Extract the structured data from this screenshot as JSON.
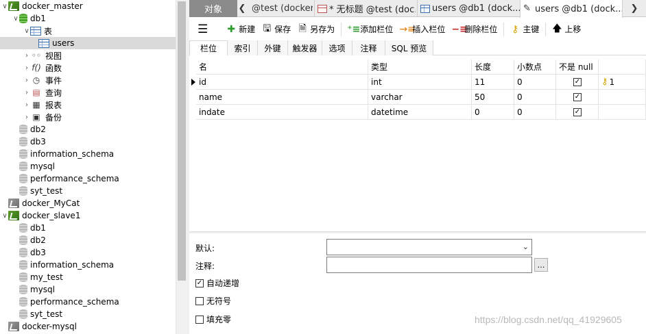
{
  "tree": {
    "items": [
      {
        "label": "docker_master",
        "arrow": "∨",
        "icon": "conn"
      },
      {
        "label": "db1",
        "arrow": "∨",
        "icon": "db-open"
      },
      {
        "label": "表",
        "arrow": "∨",
        "icon": "table"
      },
      {
        "label": "users",
        "arrow": "",
        "icon": "table"
      },
      {
        "label": "视图",
        "arrow": "›",
        "icon": "view"
      },
      {
        "label": "函数",
        "arrow": "›",
        "icon": "function"
      },
      {
        "label": "事件",
        "arrow": "›",
        "icon": "event"
      },
      {
        "label": "查询",
        "arrow": "›",
        "icon": "query"
      },
      {
        "label": "报表",
        "arrow": "›",
        "icon": "report"
      },
      {
        "label": "备份",
        "arrow": "›",
        "icon": "backup"
      },
      {
        "label": "db2",
        "arrow": "",
        "icon": "db"
      },
      {
        "label": "db3",
        "arrow": "",
        "icon": "db"
      },
      {
        "label": "information_schema",
        "arrow": "",
        "icon": "db"
      },
      {
        "label": "mysql",
        "arrow": "",
        "icon": "db"
      },
      {
        "label": "performance_schema",
        "arrow": "",
        "icon": "db"
      },
      {
        "label": "syt_test",
        "arrow": "",
        "icon": "db"
      },
      {
        "label": "docker_MyCat",
        "arrow": "",
        "icon": "conn-off"
      },
      {
        "label": "docker_slave1",
        "arrow": "∨",
        "icon": "conn"
      },
      {
        "label": "db1",
        "arrow": "",
        "icon": "db"
      },
      {
        "label": "db2",
        "arrow": "",
        "icon": "db"
      },
      {
        "label": "db3",
        "arrow": "",
        "icon": "db"
      },
      {
        "label": "information_schema",
        "arrow": "",
        "icon": "db"
      },
      {
        "label": "my_test",
        "arrow": "",
        "icon": "db"
      },
      {
        "label": "mysql",
        "arrow": "",
        "icon": "db"
      },
      {
        "label": "performance_schema",
        "arrow": "",
        "icon": "db"
      },
      {
        "label": "syt_test",
        "arrow": "",
        "icon": "db"
      },
      {
        "label": "docker-mysql",
        "arrow": "",
        "icon": "conn-off"
      }
    ]
  },
  "tabs": {
    "objects": "对象",
    "t1": "@test (docker...",
    "t2": "* 无标题 @test (doc...",
    "t3": "users @db1 (dock...",
    "t4": "users @db1 (dock..."
  },
  "toolbar": {
    "new": "新建",
    "save": "保存",
    "save_as": "另存为",
    "add_field": "添加栏位",
    "insert_field": "插入栏位",
    "delete_field": "删除栏位",
    "primary_key": "主键",
    "move_up": "上移"
  },
  "subtabs": [
    "栏位",
    "索引",
    "外键",
    "触发器",
    "选项",
    "注释",
    "SQL 预览"
  ],
  "grid": {
    "headers": {
      "name": "名",
      "type": "类型",
      "length": "长度",
      "decimals": "小数点",
      "not_null": "不是 null"
    },
    "rows": [
      {
        "name": "id",
        "type": "int",
        "length": "11",
        "decimals": "0",
        "not_null": true,
        "key": "1"
      },
      {
        "name": "name",
        "type": "varchar",
        "length": "50",
        "decimals": "0",
        "not_null": true,
        "key": ""
      },
      {
        "name": "indate",
        "type": "datetime",
        "length": "0",
        "decimals": "0",
        "not_null": true,
        "key": ""
      }
    ]
  },
  "props": {
    "default_label": "默认:",
    "comment_label": "注释:",
    "auto_increment": "自动递增",
    "unsigned": "无符号",
    "zerofill": "填充零",
    "auto_increment_checked": true,
    "unsigned_checked": false,
    "zerofill_checked": false
  },
  "watermark": "https://blog.csdn.net/qq_41929605"
}
